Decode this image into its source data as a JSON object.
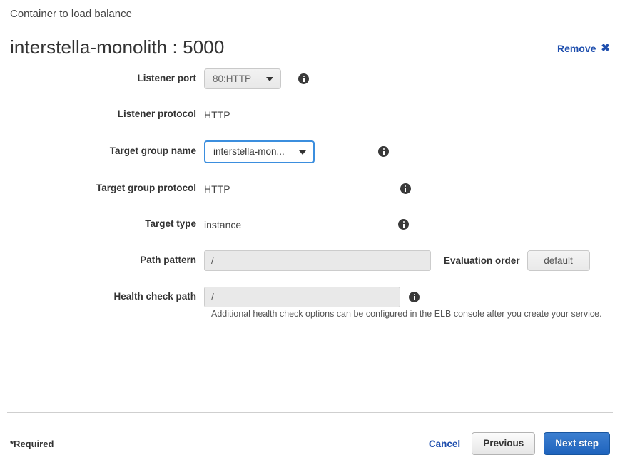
{
  "section": {
    "header": "Container to load balance"
  },
  "title": {
    "text": "interstella-monolith : 5000",
    "remove_label": "Remove",
    "remove_icon": "close-icon",
    "link_color": "#1f4fae"
  },
  "form": {
    "rows": [
      {
        "label": "Listener port",
        "type": "select",
        "value": "80:HTTP",
        "disabled": true,
        "has_info": true
      },
      {
        "label": "Listener protocol",
        "type": "static",
        "value": "HTTP",
        "has_info": false
      },
      {
        "label": "Target group name",
        "type": "select",
        "value": "interstella-mon...",
        "disabled": false,
        "has_info": true
      },
      {
        "label": "Target group protocol",
        "type": "static",
        "value": "HTTP",
        "has_info": true
      },
      {
        "label": "Target type",
        "type": "static",
        "value": "instance",
        "has_info": true
      },
      {
        "label": "Path pattern",
        "type": "text",
        "value": "/",
        "has_info": false,
        "extra_label": "Evaluation order",
        "extra_value": "default"
      },
      {
        "label": "Health check path",
        "type": "text",
        "value": "/",
        "has_info": true
      }
    ],
    "help_text": "Additional health check options can be configured in the ELB console after you create your service."
  },
  "footer": {
    "required_note": "*Required",
    "cancel_label": "Cancel",
    "previous_label": "Previous",
    "next_label": "Next step",
    "primary_color": "#2a6fc5"
  }
}
